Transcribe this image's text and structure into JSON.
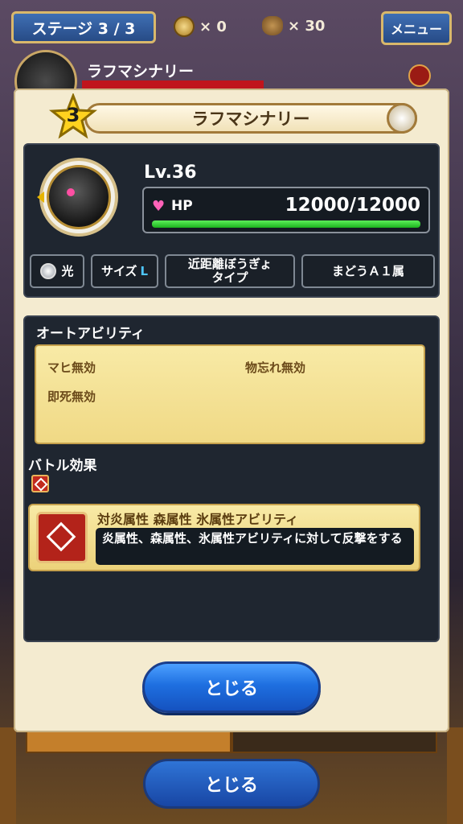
{
  "hud": {
    "stage_label": "ステージ 3 / 3",
    "coin_count": "× 0",
    "bag_count": "× 30",
    "menu_label": "メニュー",
    "bg_enemy_name": "ラフマシナリー",
    "bg_close_label": "とじる"
  },
  "modal": {
    "rank": "3",
    "title": "ラフマシナリー",
    "level": "Lv.36",
    "hp_label": "HP",
    "hp_value": "12000/12000",
    "hp_ratio": 1.0,
    "attributes": {
      "element": "光",
      "size_label": "サイズ",
      "size_value": "L",
      "range_type": "近距離ぼうぎょ\nタイプ",
      "race": "まどうＡ１属"
    },
    "auto_ability": {
      "title": "オートアビリティ",
      "items": [
        "マヒ無効",
        "物忘れ無効",
        "即死無効"
      ]
    },
    "battle_effect": {
      "title": "バトル効果",
      "name": "対炎属性 森属性 氷属性アビリティ",
      "description": "炎属性、森属性、氷属性アビリティに対して反撃をする"
    },
    "close_label": "とじる"
  },
  "colors": {
    "hp_bar": "#1cb31e",
    "panel_bg": "#1f2630",
    "modal_bg": "#f4ebd0",
    "button_blue": "#1e6fe0"
  }
}
